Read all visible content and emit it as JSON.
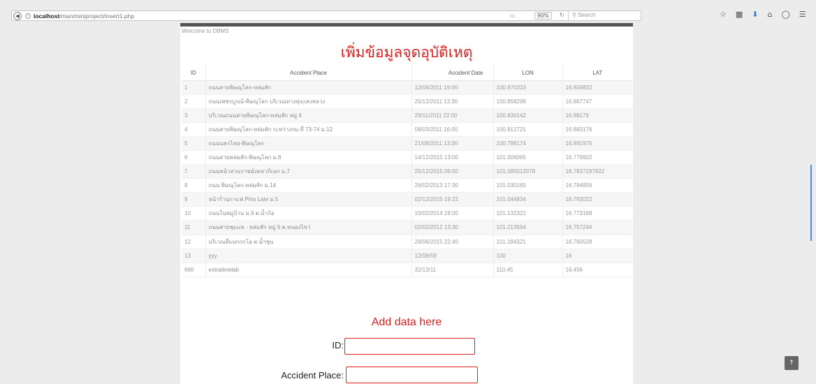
{
  "browser": {
    "url_host": "localhost",
    "url_path": "/man/miniproject/insert1.php",
    "zoom": "90%",
    "search_placeholder": "Search"
  },
  "page": {
    "welcome": "Welcome to DBMS",
    "title": "เพิ่มข้อมูลจุดอุบัติเหตุ"
  },
  "table": {
    "columns": [
      "ID",
      "Accident Place",
      "Accident Date",
      "LON",
      "LAT"
    ],
    "rows": [
      [
        "1",
        "ถนนสายพิษณุโลก-หล่มสัก",
        "12/06/2011 19:00",
        "100.870333",
        "16.859832"
      ],
      [
        "2",
        "ถนนเพชรบูรณ์-พิษณุโลก บริเวณทางทุ่งแสงหลวง",
        "25/12/2011 13:30",
        "100.858298",
        "16.867747"
      ],
      [
        "3",
        "บริเวณถนนสายพิษณุโลก-หล่มสัก หมู่ 4",
        "29/11/2011 22:00",
        "100.830142",
        "16.88179"
      ],
      [
        "4",
        "ถนนสายพิษณุโลก-หล่มสัก ระหว่างกม.ที่ 73-74 ม.12",
        "08/03/2011 16:00",
        "100.812721",
        "16.883176"
      ],
      [
        "5",
        "ถนนนครไทย-พิษณุโลก",
        "21/08/2011 13:30",
        "100.798174",
        "16.891976"
      ],
      [
        "6",
        "ถนนสายหล่มสัก-พิษณุโลก ม.8",
        "14/12/2015 13:00",
        "101.006065",
        "16.779602"
      ],
      [
        "7",
        "ถนนหน้าสวนราชมังคลาภิเษก ม.7",
        "25/12/2015 09:00",
        "101.085013378",
        "16.7837297922"
      ],
      [
        "8",
        "ถนน พิษณุโลก-หล่มสัก ม.14",
        "26/02/2013 17:30",
        "101.030165",
        "16.784856"
      ],
      [
        "9",
        "หน้าร้านกาแฟ Pino Late ม.5",
        "02/12/2015 19:22",
        "101.044834",
        "16.793022"
      ],
      [
        "10",
        "ถนนในหมู่บ้าน ม.9 ต.น้ำก้อ",
        "10/02/2014 19:00",
        "101.132322",
        "16.773168"
      ],
      [
        "11",
        "ถนนสายชุมแพ - หล่มสัก หมู่ 9 ต.หนองไขว่",
        "02/02/2012 13:30",
        "101.213564",
        "16.757244"
      ],
      [
        "12",
        "บริเวณสี่แยกกกโอ ต.น้ำชุน",
        "29/06/2015 22:40",
        "101.184321",
        "16.760528"
      ],
      [
        "13",
        "yyy",
        "12/08/59",
        "100",
        "16"
      ],
      [
        "666",
        "extratimelab",
        "32/13/11",
        "110.45",
        "16.456"
      ]
    ]
  },
  "form": {
    "heading": "Add data here",
    "id_label": "ID:",
    "place_label": "Accident Place:"
  },
  "colors": {
    "accent": "#e02020",
    "header_bar": "#555555"
  }
}
